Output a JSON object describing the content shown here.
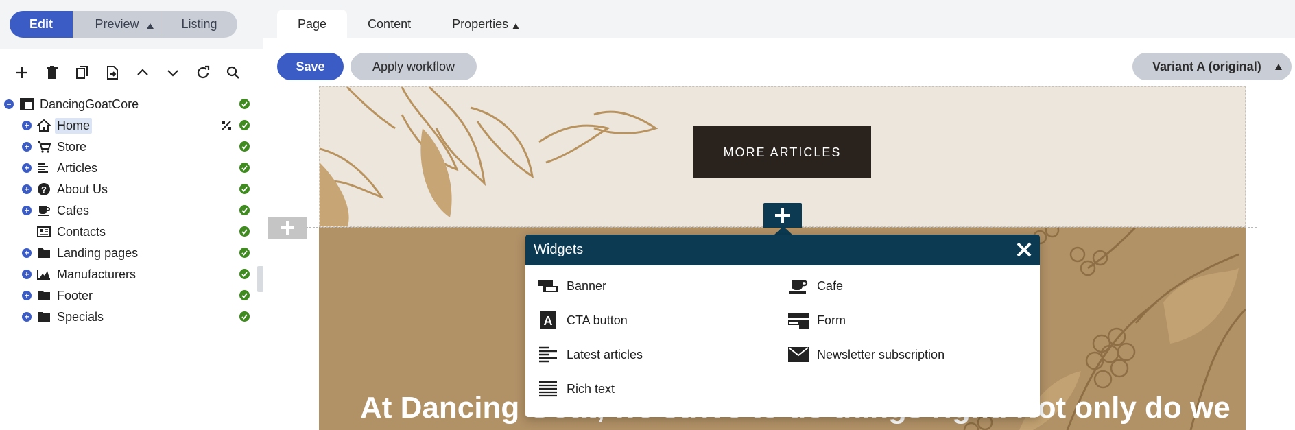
{
  "mode_switch": {
    "edit": "Edit",
    "preview": "Preview",
    "listing": "Listing"
  },
  "toolbar": {
    "icons": [
      "plus-icon",
      "trash-icon",
      "copy-icon",
      "move-icon",
      "chevron-up-icon",
      "chevron-down-icon",
      "refresh-icon",
      "search-icon"
    ]
  },
  "tree": {
    "root": "DancingGoatCore",
    "items": [
      {
        "label": "Home",
        "icon": "home-icon",
        "selected": true
      },
      {
        "label": "Store",
        "icon": "cart-icon"
      },
      {
        "label": "Articles",
        "icon": "articles-icon"
      },
      {
        "label": "About Us",
        "icon": "question-icon"
      },
      {
        "label": "Cafes",
        "icon": "cup-icon"
      },
      {
        "label": "Contacts",
        "icon": "contacts-icon"
      },
      {
        "label": "Landing pages",
        "icon": "folder-icon"
      },
      {
        "label": "Manufacturers",
        "icon": "chart-icon"
      },
      {
        "label": "Footer",
        "icon": "folder-icon"
      },
      {
        "label": "Specials",
        "icon": "folder-icon"
      }
    ]
  },
  "tabs": {
    "page": "Page",
    "content": "Content",
    "properties": "Properties"
  },
  "actions": {
    "save": "Save",
    "apply_workflow": "Apply workflow",
    "variant": "Variant A (original)"
  },
  "canvas": {
    "more_articles": "MORE ARTICLES",
    "headline": "At Dancing Goat, we strive to do things right. Not only do we"
  },
  "widgets": {
    "title": "Widgets",
    "items": [
      {
        "label": "Banner",
        "icon": "banner-icon"
      },
      {
        "label": "Cafe",
        "icon": "cafe-icon"
      },
      {
        "label": "CTA button",
        "icon": "cta-icon"
      },
      {
        "label": "Form",
        "icon": "form-icon"
      },
      {
        "label": "Latest articles",
        "icon": "latest-articles-icon"
      },
      {
        "label": "Newsletter subscription",
        "icon": "envelope-icon"
      },
      {
        "label": "Rich text",
        "icon": "rich-text-icon"
      }
    ]
  },
  "colors": {
    "accent": "#3b5cc4",
    "widget_header": "#0b3a52",
    "status_ok": "#3f8b1f",
    "section_brown": "#b19166",
    "section_beige": "#ede6dc"
  }
}
